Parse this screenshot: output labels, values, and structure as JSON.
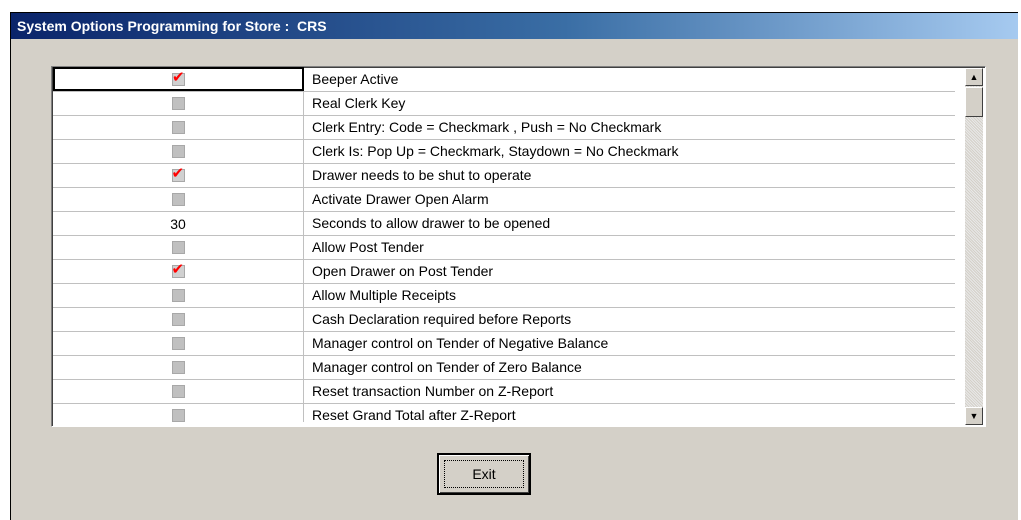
{
  "window": {
    "title": "System Options Programming for Store :  CRS"
  },
  "options": [
    {
      "type": "checkbox",
      "checked": true,
      "value": "",
      "label": "Beeper Active"
    },
    {
      "type": "checkbox",
      "checked": false,
      "value": "",
      "label": "Real Clerk Key"
    },
    {
      "type": "checkbox",
      "checked": false,
      "value": "",
      "label": "Clerk Entry:  Code = Checkmark , Push = No Checkmark"
    },
    {
      "type": "checkbox",
      "checked": false,
      "value": "",
      "label": "Clerk Is:  Pop Up = Checkmark,  Staydown = No Checkmark"
    },
    {
      "type": "checkbox",
      "checked": true,
      "value": "",
      "label": "Drawer needs to be shut to operate"
    },
    {
      "type": "checkbox",
      "checked": false,
      "value": "",
      "label": "Activate Drawer Open Alarm"
    },
    {
      "type": "number",
      "checked": false,
      "value": "30",
      "label": "Seconds to allow drawer to be opened"
    },
    {
      "type": "checkbox",
      "checked": false,
      "value": "",
      "label": "Allow Post Tender"
    },
    {
      "type": "checkbox",
      "checked": true,
      "value": "",
      "label": "Open Drawer on Post Tender"
    },
    {
      "type": "checkbox",
      "checked": false,
      "value": "",
      "label": "Allow Multiple Receipts"
    },
    {
      "type": "checkbox",
      "checked": false,
      "value": "",
      "label": "Cash Declaration required before Reports"
    },
    {
      "type": "checkbox",
      "checked": false,
      "value": "",
      "label": "Manager control on Tender of Negative Balance"
    },
    {
      "type": "checkbox",
      "checked": false,
      "value": "",
      "label": "Manager control on Tender of Zero Balance"
    },
    {
      "type": "checkbox",
      "checked": false,
      "value": "",
      "label": "Reset transaction Number on Z-Report"
    },
    {
      "type": "checkbox",
      "checked": false,
      "value": "",
      "label": "Reset Grand Total after Z-Report"
    }
  ],
  "checkmark_glyph": "✔",
  "checkmark_color": "#ff0000",
  "scrollbar": {
    "up_glyph": "▲",
    "down_glyph": "▼"
  },
  "exit_button": {
    "label": "Exit"
  }
}
